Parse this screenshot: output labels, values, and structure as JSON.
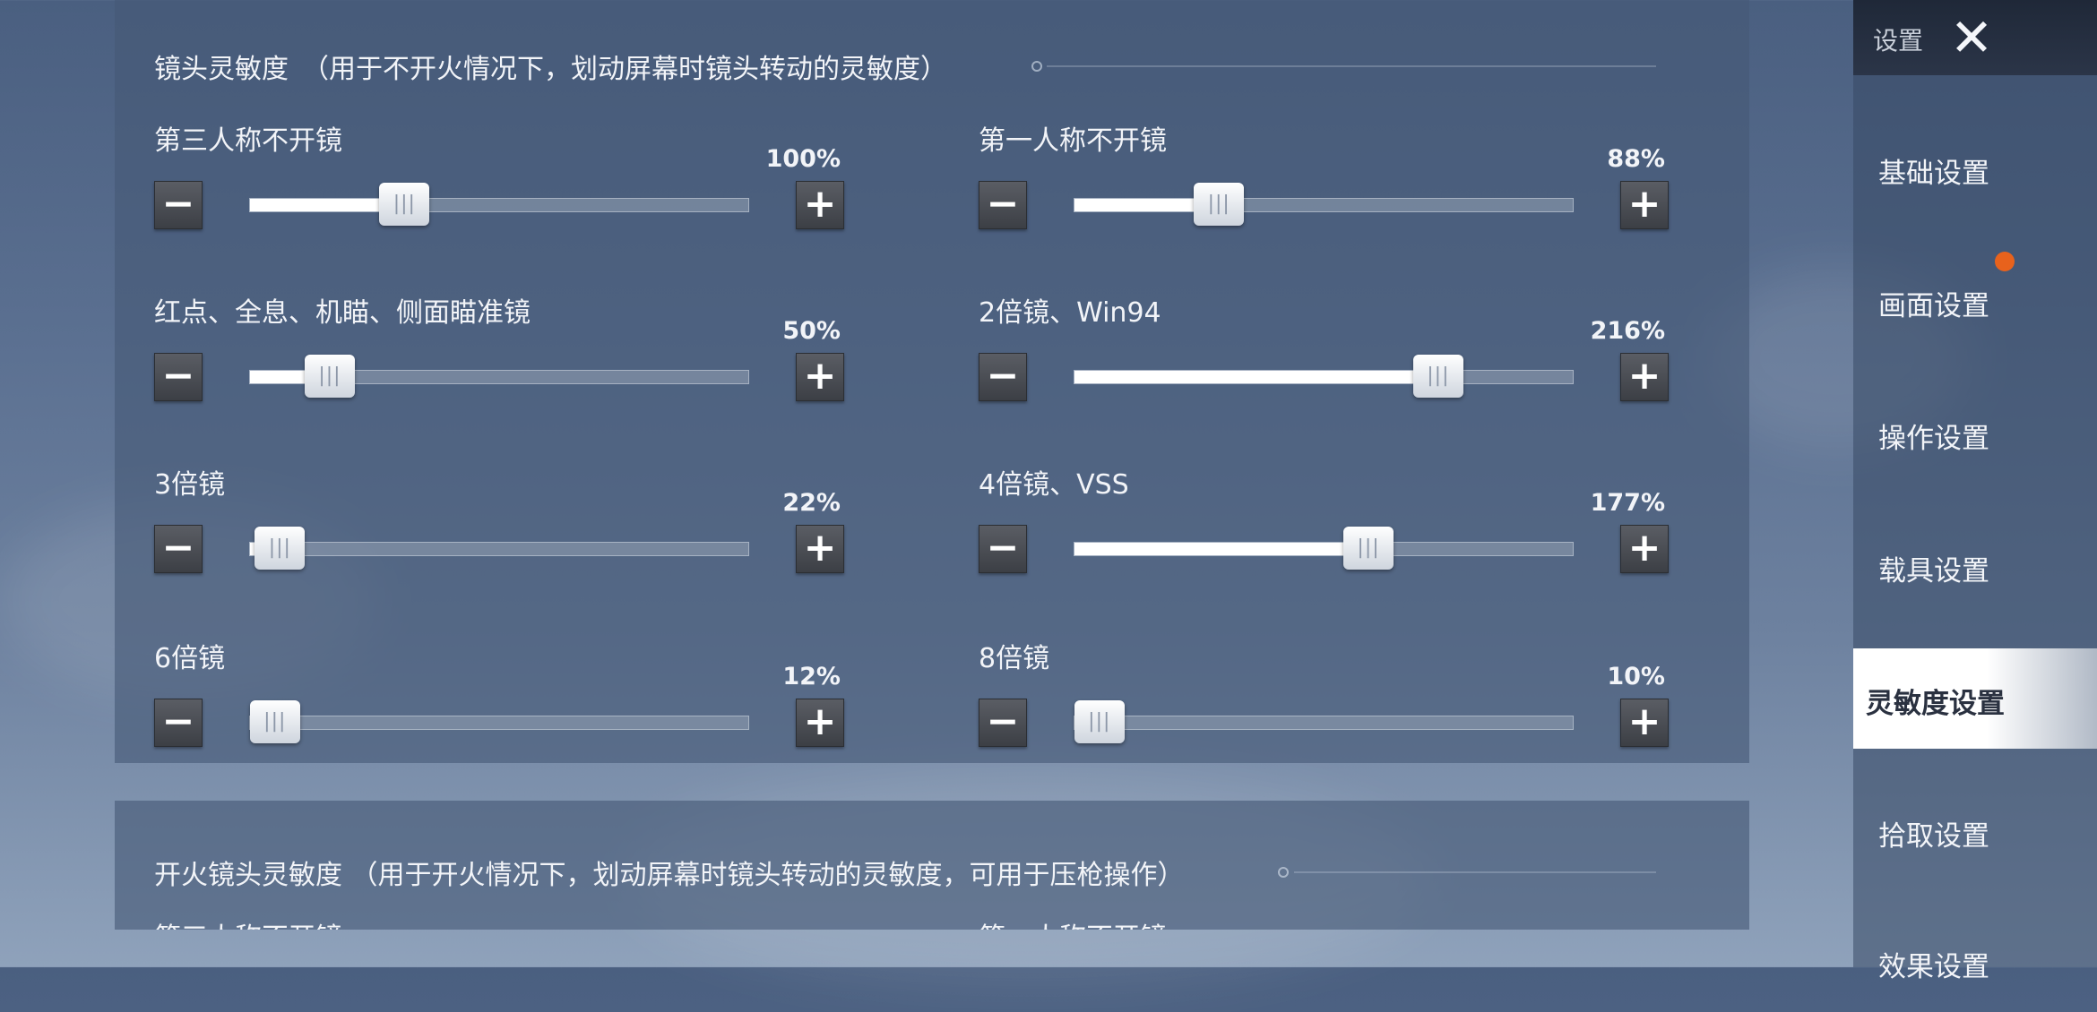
{
  "camera_section": {
    "title": "镜头灵敏度　（用于不开火情况下，划动屏幕时镜头转动的灵敏度）",
    "settings": [
      {
        "label": "第三人称不开镜",
        "value_text": "100%",
        "fraction": 0.31
      },
      {
        "label": "第一人称不开镜",
        "value_text": "88%",
        "fraction": 0.29
      },
      {
        "label": "红点、全息、机瞄、侧面瞄准镜",
        "value_text": "50%",
        "fraction": 0.16
      },
      {
        "label": "2倍镜、Win94",
        "value_text": "216%",
        "fraction": 0.73
      },
      {
        "label": "3倍镜",
        "value_text": "22%",
        "fraction": 0.06
      },
      {
        "label": "4倍镜、VSS",
        "value_text": "177%",
        "fraction": 0.59
      },
      {
        "label": "6倍镜",
        "value_text": "12%",
        "fraction": 0.03
      },
      {
        "label": "8倍镜",
        "value_text": "10%",
        "fraction": 0.02
      }
    ]
  },
  "fire_section": {
    "title": "开火镜头灵敏度 （用于开火情况下，划动屏幕时镜头转动的灵敏度，可用于压枪操作）",
    "partial_labels": [
      "第三人称不开镜",
      "第一人称不开镜"
    ]
  },
  "controls": {
    "minus": "−",
    "plus": "+",
    "thumb_grip": "|||"
  },
  "sidebar": {
    "title": "设置",
    "close_symbol": "✕",
    "items": [
      {
        "label": "基础设置"
      },
      {
        "label": "画面设置"
      },
      {
        "label": "操作设置"
      },
      {
        "label": "载具设置"
      },
      {
        "label": "灵敏度设置"
      },
      {
        "label": "拾取设置"
      },
      {
        "label": "效果设置"
      }
    ],
    "active_item": "灵敏度设置",
    "notification_item": "画面设置"
  },
  "colors": {
    "accent_active": "#ffffff",
    "notification": "#e8621c",
    "panel": "#465876"
  }
}
